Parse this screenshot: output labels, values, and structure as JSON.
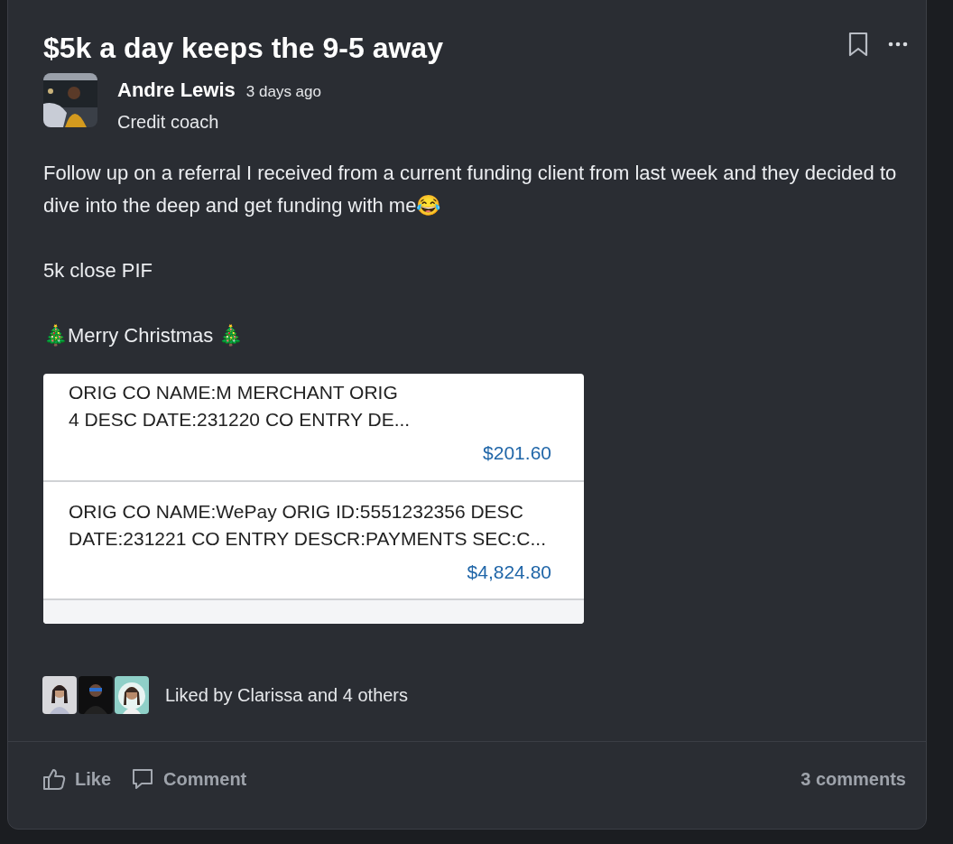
{
  "post": {
    "title": "$5k a day keeps the 9-5 away",
    "author": {
      "name": "Andre Lewis",
      "time": "3 days ago",
      "role": "Credit coach"
    },
    "body": [
      "Follow up on a referral I received from a current funding client from last week and they decided to dive into the deep and get funding with me😂",
      "5k close PIF",
      "🎄Merry Christmas 🎄"
    ],
    "attachment": {
      "transactions": [
        {
          "lines": [
            "ORIG CO NAME:M MERCHANT ORIG",
            "4 DESC DATE:231220 CO ENTRY DE..."
          ],
          "amount": "$201.60"
        },
        {
          "lines": [
            "ORIG CO NAME:WePay ORIG ID:5551232356 DESC",
            "DATE:231221 CO ENTRY DESCR:PAYMENTS SEC:C..."
          ],
          "amount": "$4,824.80"
        }
      ]
    },
    "likes": {
      "text": "Liked by Clarissa and 4 others"
    },
    "actions": [
      {
        "kind": "like",
        "label": "Like"
      },
      {
        "kind": "comment",
        "label": "Comment"
      }
    ],
    "comments_count": "3 comments"
  }
}
